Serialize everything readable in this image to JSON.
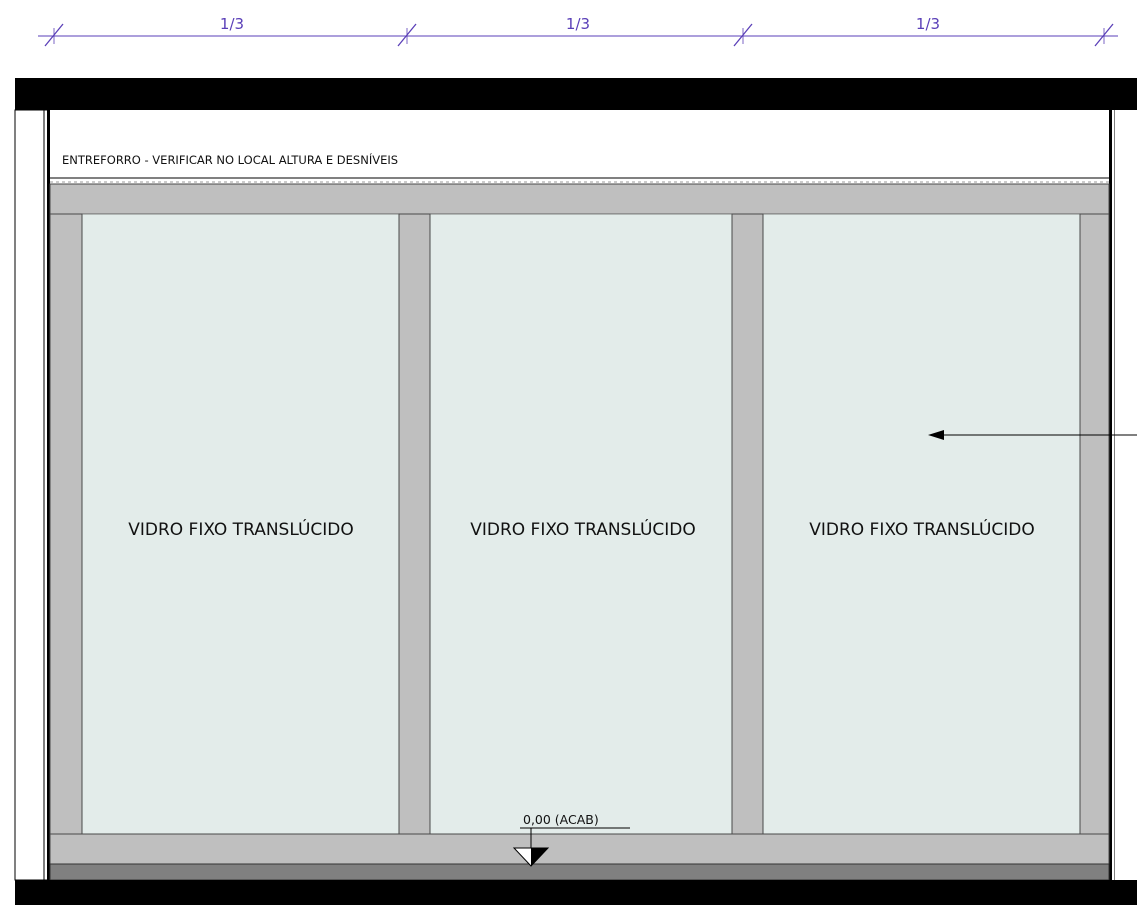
{
  "dimensions": {
    "labels": [
      "1/3",
      "1/3",
      "1/3"
    ]
  },
  "ceiling_note": "ENTREFORRO - VERIFICAR NO LOCAL ALTURA E DESNÍVEIS",
  "panels": [
    {
      "label": "VIDRO FIXO TRANSLÚCIDO"
    },
    {
      "label": "VIDRO FIXO TRANSLÚCIDO"
    },
    {
      "label": "VIDRO FIXO TRANSLÚCIDO"
    }
  ],
  "level_marker": {
    "label": "0,00 (ACAB)"
  },
  "colors": {
    "dimension_line": "#5a3fb8",
    "glass": "#e3ecea",
    "frame": "#bfbfbf",
    "slab": "#000000",
    "floor_band": "#808080"
  }
}
